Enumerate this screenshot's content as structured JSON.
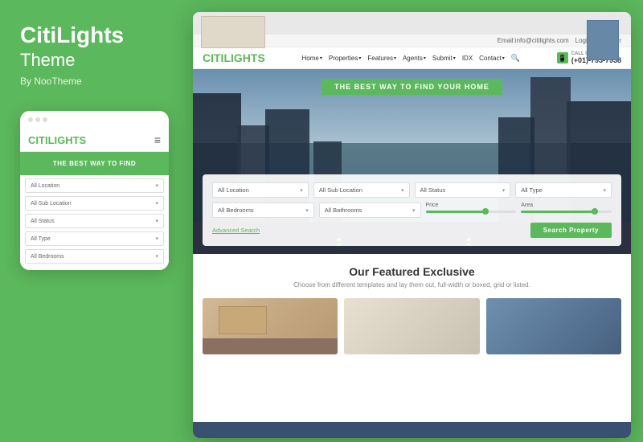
{
  "brand": {
    "name": "CitiLights",
    "subtitle": "Theme",
    "by": "By NooTheme"
  },
  "mobile": {
    "logo_citi": "CITI",
    "logo_lights": "LIGHTS",
    "hero_text": "THE BEST WAY TO FIND",
    "selects": [
      {
        "label": "All Location"
      },
      {
        "label": "All Sub Location"
      },
      {
        "label": "All Status"
      },
      {
        "label": "All Type"
      },
      {
        "label": "All Bedrooms"
      }
    ]
  },
  "desktop": {
    "topbar": {
      "email": "Email:info@citilights.com",
      "login": "Login",
      "register": "Register"
    },
    "nav": {
      "logo_citi": "CITI",
      "logo_lights": "LIGHTS",
      "links": [
        "Home",
        "Properties",
        "Features",
        "Agents",
        "Submit",
        "IDX",
        "Contact"
      ],
      "phone_label": "CALL US NOW!",
      "phone": "(+01)-793-7938"
    },
    "hero": {
      "badge": "THE BEST WAY TO FIND YOUR HOME"
    },
    "search_form": {
      "selects": [
        {
          "label": "All Location"
        },
        {
          "label": "All Sub Location"
        },
        {
          "label": "All Status"
        },
        {
          "label": "All Type"
        },
        {
          "label": "All Bedrooms"
        },
        {
          "label": "All Bathrooms"
        }
      ],
      "price_label": "Price",
      "area_label": "Area",
      "advanced_link": "Advanced Search",
      "search_btn": "Search Property"
    },
    "featured": {
      "title": "Our Featured Exclusive",
      "subtitle": "Choose from different templates and lay them out, full-width or boxed, grid or listed."
    }
  }
}
